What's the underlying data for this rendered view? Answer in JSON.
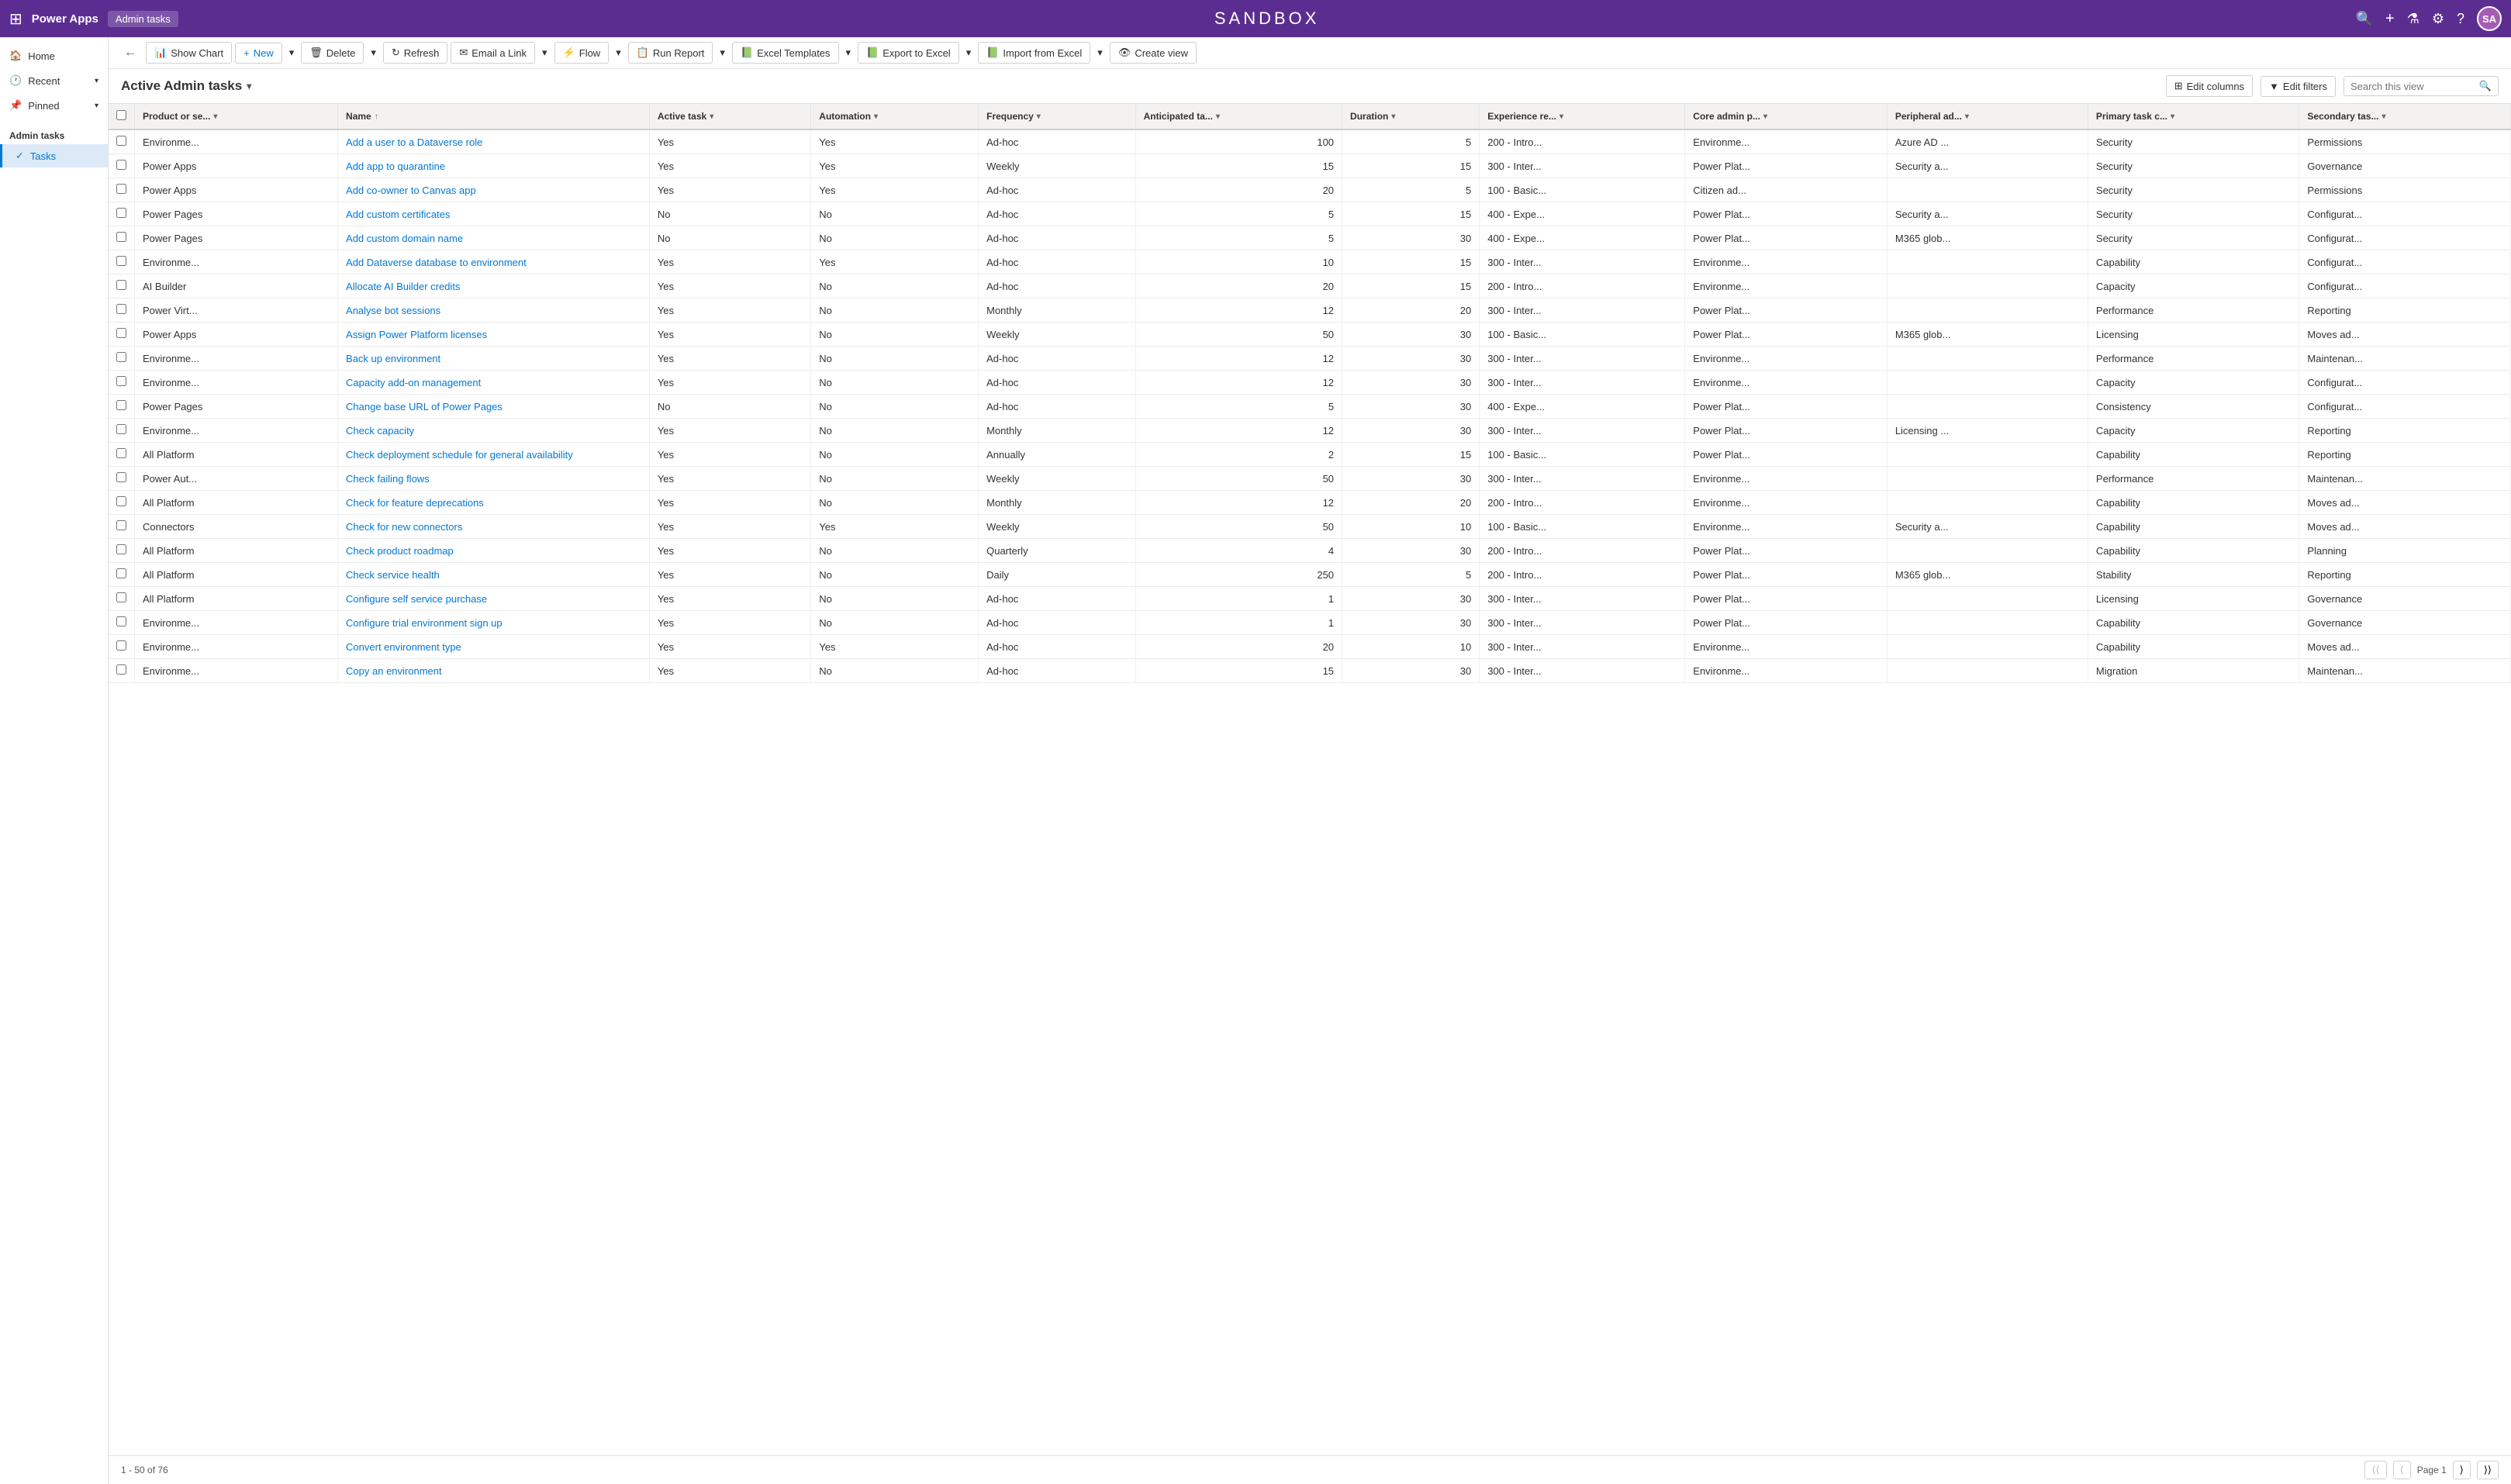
{
  "topNav": {
    "appName": "Power Apps",
    "pageTitle": "Admin tasks",
    "sandboxTitle": "SANDBOX",
    "avatarInitials": "SA",
    "icons": [
      "search",
      "add",
      "filter",
      "settings",
      "help"
    ]
  },
  "sidebar": {
    "hamburger": "☰",
    "items": [
      {
        "id": "home",
        "label": "Home",
        "icon": "🏠"
      },
      {
        "id": "recent",
        "label": "Recent",
        "icon": "🕐",
        "hasArrow": true
      },
      {
        "id": "pinned",
        "label": "Pinned",
        "icon": "📌",
        "hasArrow": true
      }
    ],
    "sectionLabel": "Admin tasks",
    "subItems": [
      {
        "id": "tasks",
        "label": "Tasks",
        "icon": "✓",
        "active": true
      }
    ]
  },
  "toolbar": {
    "backLabel": "←",
    "showChartLabel": "Show Chart",
    "newLabel": "New",
    "deleteLabel": "Delete",
    "refreshLabel": "Refresh",
    "emailLinkLabel": "Email a Link",
    "flowLabel": "Flow",
    "runReportLabel": "Run Report",
    "excelTemplatesLabel": "Excel Templates",
    "exportToExcelLabel": "Export to Excel",
    "importFromExcelLabel": "Import from Excel",
    "createViewLabel": "Create view"
  },
  "viewHeader": {
    "title": "Active Admin tasks",
    "editColumnsLabel": "Edit columns",
    "editFiltersLabel": "Edit filters",
    "searchPlaceholder": "Search this view"
  },
  "table": {
    "columns": [
      {
        "id": "product",
        "label": "Product or se..."
      },
      {
        "id": "name",
        "label": "Name"
      },
      {
        "id": "activeTask",
        "label": "Active task"
      },
      {
        "id": "automation",
        "label": "Automation"
      },
      {
        "id": "frequency",
        "label": "Frequency"
      },
      {
        "id": "anticipatedTa",
        "label": "Anticipated ta..."
      },
      {
        "id": "duration",
        "label": "Duration"
      },
      {
        "id": "experienceRe",
        "label": "Experience re..."
      },
      {
        "id": "coreAdminP",
        "label": "Core admin p..."
      },
      {
        "id": "peripheralAd",
        "label": "Peripheral ad..."
      },
      {
        "id": "primaryTaskC",
        "label": "Primary task c..."
      },
      {
        "id": "secondaryTas",
        "label": "Secondary tas..."
      }
    ],
    "rows": [
      {
        "product": "Environme...",
        "name": "Add a user to a Dataverse role",
        "activeTask": "Yes",
        "automation": "Yes",
        "frequency": "Ad-hoc",
        "anticipatedTa": "100",
        "duration": "5",
        "experienceRe": "200 - Intro...",
        "coreAdminP": "Environme...",
        "peripheralAd": "Azure AD ...",
        "primaryTaskC": "Security",
        "secondaryTas": "Permissions"
      },
      {
        "product": "Power Apps",
        "name": "Add app to quarantine",
        "activeTask": "Yes",
        "automation": "Yes",
        "frequency": "Weekly",
        "anticipatedTa": "15",
        "duration": "15",
        "experienceRe": "300 - Inter...",
        "coreAdminP": "Power Plat...",
        "peripheralAd": "Security a...",
        "primaryTaskC": "Security",
        "secondaryTas": "Governance"
      },
      {
        "product": "Power Apps",
        "name": "Add co-owner to Canvas app",
        "activeTask": "Yes",
        "automation": "Yes",
        "frequency": "Ad-hoc",
        "anticipatedTa": "20",
        "duration": "5",
        "experienceRe": "100 - Basic...",
        "coreAdminP": "Citizen ad...",
        "peripheralAd": "",
        "primaryTaskC": "Security",
        "secondaryTas": "Permissions"
      },
      {
        "product": "Power Pages",
        "name": "Add custom certificates",
        "activeTask": "No",
        "automation": "No",
        "frequency": "Ad-hoc",
        "anticipatedTa": "5",
        "duration": "15",
        "experienceRe": "400 - Expe...",
        "coreAdminP": "Power Plat...",
        "peripheralAd": "Security a...",
        "primaryTaskC": "Security",
        "secondaryTas": "Configurat..."
      },
      {
        "product": "Power Pages",
        "name": "Add custom domain name",
        "activeTask": "No",
        "automation": "No",
        "frequency": "Ad-hoc",
        "anticipatedTa": "5",
        "duration": "30",
        "experienceRe": "400 - Expe...",
        "coreAdminP": "Power Plat...",
        "peripheralAd": "M365 glob...",
        "primaryTaskC": "Security",
        "secondaryTas": "Configurat..."
      },
      {
        "product": "Environme...",
        "name": "Add Dataverse database to environment",
        "activeTask": "Yes",
        "automation": "Yes",
        "frequency": "Ad-hoc",
        "anticipatedTa": "10",
        "duration": "15",
        "experienceRe": "300 - Inter...",
        "coreAdminP": "Environme...",
        "peripheralAd": "",
        "primaryTaskC": "Capability",
        "secondaryTas": "Configurat..."
      },
      {
        "product": "AI Builder",
        "name": "Allocate AI Builder credits",
        "activeTask": "Yes",
        "automation": "No",
        "frequency": "Ad-hoc",
        "anticipatedTa": "20",
        "duration": "15",
        "experienceRe": "200 - Intro...",
        "coreAdminP": "Environme...",
        "peripheralAd": "",
        "primaryTaskC": "Capacity",
        "secondaryTas": "Configurat..."
      },
      {
        "product": "Power Virt...",
        "name": "Analyse bot sessions",
        "activeTask": "Yes",
        "automation": "No",
        "frequency": "Monthly",
        "anticipatedTa": "12",
        "duration": "20",
        "experienceRe": "300 - Inter...",
        "coreAdminP": "Power Plat...",
        "peripheralAd": "",
        "primaryTaskC": "Performance",
        "secondaryTas": "Reporting"
      },
      {
        "product": "Power Apps",
        "name": "Assign Power Platform licenses",
        "activeTask": "Yes",
        "automation": "No",
        "frequency": "Weekly",
        "anticipatedTa": "50",
        "duration": "30",
        "experienceRe": "100 - Basic...",
        "coreAdminP": "Power Plat...",
        "peripheralAd": "M365 glob...",
        "primaryTaskC": "Licensing",
        "secondaryTas": "Moves ad..."
      },
      {
        "product": "Environme...",
        "name": "Back up environment",
        "activeTask": "Yes",
        "automation": "No",
        "frequency": "Ad-hoc",
        "anticipatedTa": "12",
        "duration": "30",
        "experienceRe": "300 - Inter...",
        "coreAdminP": "Environme...",
        "peripheralAd": "",
        "primaryTaskC": "Performance",
        "secondaryTas": "Maintenan..."
      },
      {
        "product": "Environme...",
        "name": "Capacity add-on management",
        "activeTask": "Yes",
        "automation": "No",
        "frequency": "Ad-hoc",
        "anticipatedTa": "12",
        "duration": "30",
        "experienceRe": "300 - Inter...",
        "coreAdminP": "Environme...",
        "peripheralAd": "",
        "primaryTaskC": "Capacity",
        "secondaryTas": "Configurat..."
      },
      {
        "product": "Power Pages",
        "name": "Change base URL of Power Pages",
        "activeTask": "No",
        "automation": "No",
        "frequency": "Ad-hoc",
        "anticipatedTa": "5",
        "duration": "30",
        "experienceRe": "400 - Expe...",
        "coreAdminP": "Power Plat...",
        "peripheralAd": "",
        "primaryTaskC": "Consistency",
        "secondaryTas": "Configurat..."
      },
      {
        "product": "Environme...",
        "name": "Check capacity",
        "activeTask": "Yes",
        "automation": "No",
        "frequency": "Monthly",
        "anticipatedTa": "12",
        "duration": "30",
        "experienceRe": "300 - Inter...",
        "coreAdminP": "Power Plat...",
        "peripheralAd": "Licensing ...",
        "primaryTaskC": "Capacity",
        "secondaryTas": "Reporting"
      },
      {
        "product": "All Platform",
        "name": "Check deployment schedule for general availability",
        "activeTask": "Yes",
        "automation": "No",
        "frequency": "Annually",
        "anticipatedTa": "2",
        "duration": "15",
        "experienceRe": "100 - Basic...",
        "coreAdminP": "Power Plat...",
        "peripheralAd": "",
        "primaryTaskC": "Capability",
        "secondaryTas": "Reporting"
      },
      {
        "product": "Power Aut...",
        "name": "Check failing flows",
        "activeTask": "Yes",
        "automation": "No",
        "frequency": "Weekly",
        "anticipatedTa": "50",
        "duration": "30",
        "experienceRe": "300 - Inter...",
        "coreAdminP": "Environme...",
        "peripheralAd": "",
        "primaryTaskC": "Performance",
        "secondaryTas": "Maintenan..."
      },
      {
        "product": "All Platform",
        "name": "Check for feature deprecations",
        "activeTask": "Yes",
        "automation": "No",
        "frequency": "Monthly",
        "anticipatedTa": "12",
        "duration": "20",
        "experienceRe": "200 - Intro...",
        "coreAdminP": "Environme...",
        "peripheralAd": "",
        "primaryTaskC": "Capability",
        "secondaryTas": "Moves ad..."
      },
      {
        "product": "Connectors",
        "name": "Check for new connectors",
        "activeTask": "Yes",
        "automation": "Yes",
        "frequency": "Weekly",
        "anticipatedTa": "50",
        "duration": "10",
        "experienceRe": "100 - Basic...",
        "coreAdminP": "Environme...",
        "peripheralAd": "Security a...",
        "primaryTaskC": "Capability",
        "secondaryTas": "Moves ad..."
      },
      {
        "product": "All Platform",
        "name": "Check product roadmap",
        "activeTask": "Yes",
        "automation": "No",
        "frequency": "Quarterly",
        "anticipatedTa": "4",
        "duration": "30",
        "experienceRe": "200 - Intro...",
        "coreAdminP": "Power Plat...",
        "peripheralAd": "",
        "primaryTaskC": "Capability",
        "secondaryTas": "Planning"
      },
      {
        "product": "All Platform",
        "name": "Check service health",
        "activeTask": "Yes",
        "automation": "No",
        "frequency": "Daily",
        "anticipatedTa": "250",
        "duration": "5",
        "experienceRe": "200 - Intro...",
        "coreAdminP": "Power Plat...",
        "peripheralAd": "M365 glob...",
        "primaryTaskC": "Stability",
        "secondaryTas": "Reporting"
      },
      {
        "product": "All Platform",
        "name": "Configure self service purchase",
        "activeTask": "Yes",
        "automation": "No",
        "frequency": "Ad-hoc",
        "anticipatedTa": "1",
        "duration": "30",
        "experienceRe": "300 - Inter...",
        "coreAdminP": "Power Plat...",
        "peripheralAd": "",
        "primaryTaskC": "Licensing",
        "secondaryTas": "Governance"
      },
      {
        "product": "Environme...",
        "name": "Configure trial environment sign up",
        "activeTask": "Yes",
        "automation": "No",
        "frequency": "Ad-hoc",
        "anticipatedTa": "1",
        "duration": "30",
        "experienceRe": "300 - Inter...",
        "coreAdminP": "Power Plat...",
        "peripheralAd": "",
        "primaryTaskC": "Capability",
        "secondaryTas": "Governance"
      },
      {
        "product": "Environme...",
        "name": "Convert environment type",
        "activeTask": "Yes",
        "automation": "Yes",
        "frequency": "Ad-hoc",
        "anticipatedTa": "20",
        "duration": "10",
        "experienceRe": "300 - Inter...",
        "coreAdminP": "Environme...",
        "peripheralAd": "",
        "primaryTaskC": "Capability",
        "secondaryTas": "Moves ad..."
      },
      {
        "product": "Environme...",
        "name": "Copy an environment",
        "activeTask": "Yes",
        "automation": "No",
        "frequency": "Ad-hoc",
        "anticipatedTa": "15",
        "duration": "30",
        "experienceRe": "300 - Inter...",
        "coreAdminP": "Environme...",
        "peripheralAd": "",
        "primaryTaskC": "Migration",
        "secondaryTas": "Maintenan..."
      }
    ]
  },
  "pagination": {
    "rangeLabel": "1 - 50 of 76",
    "pageLabel": "Page 1",
    "firstBtn": "⟨⟨",
    "prevBtn": "⟨",
    "nextBtn": "⟩",
    "lastBtn": "⟩⟩"
  }
}
